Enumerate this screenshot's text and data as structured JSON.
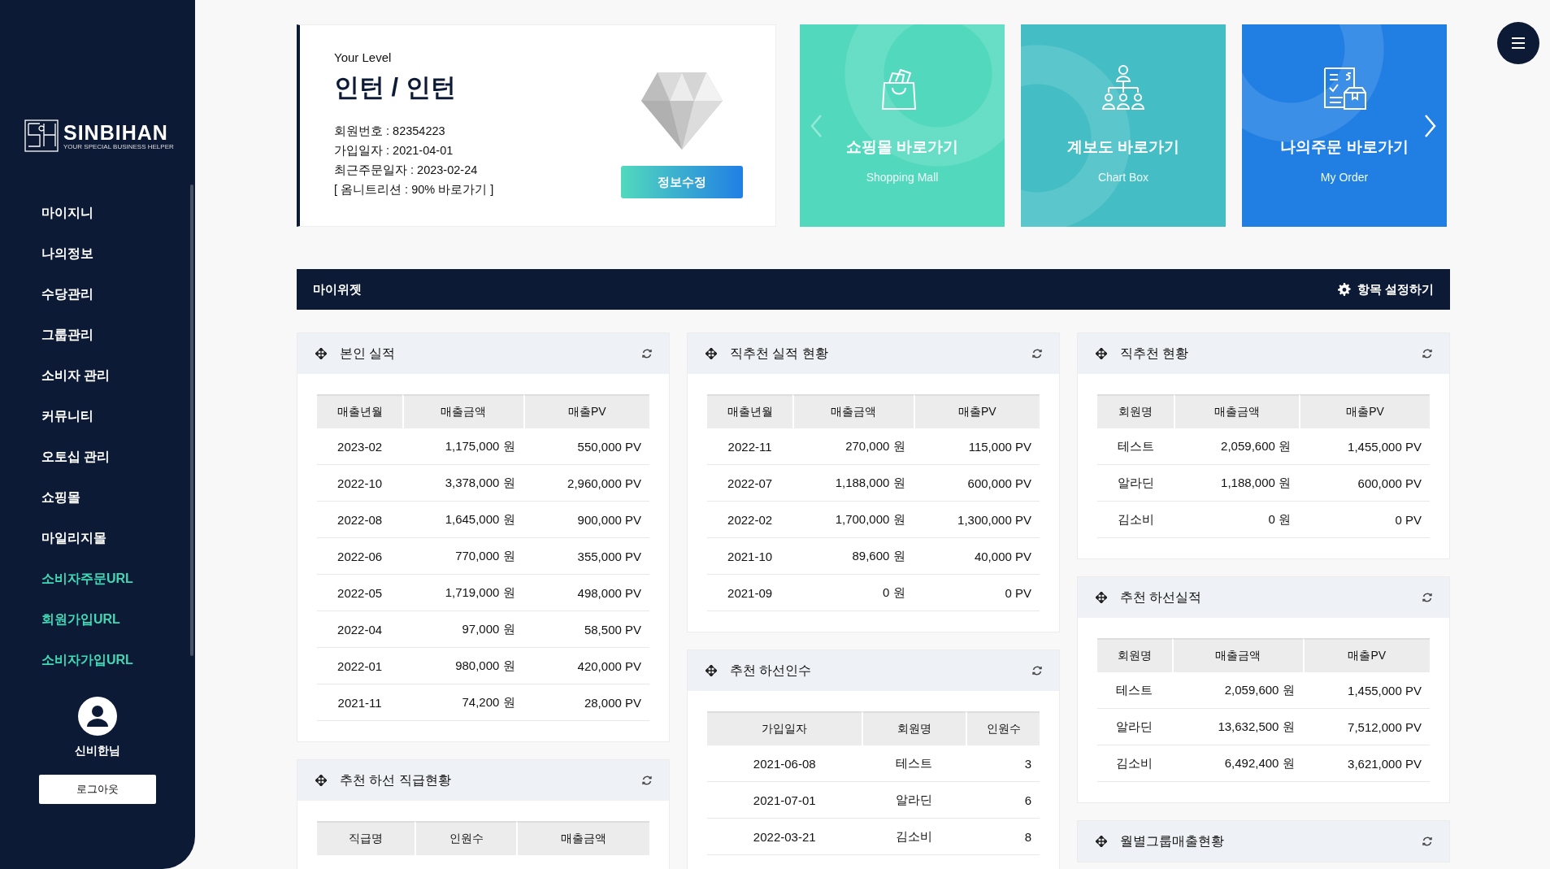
{
  "sidebar": {
    "logo": {
      "name": "SINBIHAN",
      "tagline": "YOUR SPECIAL BUSINESS HELPER"
    },
    "items": [
      {
        "label": "마이지니",
        "kind": "menu"
      },
      {
        "label": "나의정보",
        "kind": "menu"
      },
      {
        "label": "수당관리",
        "kind": "menu"
      },
      {
        "label": "그룹관리",
        "kind": "menu"
      },
      {
        "label": "소비자 관리",
        "kind": "menu"
      },
      {
        "label": "커뮤니티",
        "kind": "menu"
      },
      {
        "label": "오토십 관리",
        "kind": "menu"
      },
      {
        "label": "쇼핑몰",
        "kind": "menu"
      },
      {
        "label": "마일리지몰",
        "kind": "menu"
      },
      {
        "label": "소비자주문URL",
        "kind": "url"
      },
      {
        "label": "회원가입URL",
        "kind": "url"
      },
      {
        "label": "소비자가입URL",
        "kind": "url"
      }
    ],
    "user": {
      "name": "신비한님"
    },
    "logout": "로그아웃"
  },
  "level_card": {
    "caption": "Your Level",
    "title": "인턴 / 인턴",
    "details": [
      "회원번호 : 82354223",
      "가입일자 : 2021-04-01",
      "최근주문일자 : 2023-02-24",
      "[ 옴니트리션 : 90% 바로가기 ]"
    ],
    "button": "정보수정"
  },
  "carousel": {
    "prev": {
      "disabled": true
    },
    "next": {
      "disabled": false
    }
  },
  "shortcuts": [
    {
      "title": "쇼핑몰 바로가기",
      "subtitle": "Shopping Mall",
      "color": "#52d9bd",
      "kind": "shopping"
    },
    {
      "title": "계보도 바로가기",
      "subtitle": "Chart Box",
      "color": "#44bec4",
      "kind": "chart"
    },
    {
      "title": "나의주문 바로가기",
      "subtitle": "My Order",
      "color": "#217fe4",
      "kind": "order"
    }
  ],
  "widget_bar": {
    "title": "마이위젯",
    "action": "항목 설정하기"
  },
  "widget_columns": [
    [
      {
        "title": "본인 실적",
        "columns": [
          {
            "label": "매출년월",
            "kind": "text"
          },
          {
            "label": "매출금액",
            "kind": "number"
          },
          {
            "label": "매출PV",
            "kind": "number"
          }
        ],
        "rows": [
          [
            "2023-02",
            "1,175,000 원",
            "550,000 PV"
          ],
          [
            "2022-10",
            "3,378,000 원",
            "2,960,000 PV"
          ],
          [
            "2022-08",
            "1,645,000 원",
            "900,000 PV"
          ],
          [
            "2022-06",
            "770,000 원",
            "355,000 PV"
          ],
          [
            "2022-05",
            "1,719,000 원",
            "498,000 PV"
          ],
          [
            "2022-04",
            "97,000 원",
            "58,500 PV"
          ],
          [
            "2022-01",
            "980,000 원",
            "420,000 PV"
          ],
          [
            "2021-11",
            "74,200 원",
            "28,000 PV"
          ]
        ]
      },
      {
        "title": "추천 하선 직급현황",
        "columns": [
          {
            "label": "직급명",
            "kind": "text"
          },
          {
            "label": "인원수",
            "kind": "number"
          },
          {
            "label": "매출금액",
            "kind": "number"
          }
        ]
      }
    ],
    [
      {
        "title": "직추천 실적 현황",
        "columns": [
          {
            "label": "매출년월",
            "kind": "text"
          },
          {
            "label": "매출금액",
            "kind": "number"
          },
          {
            "label": "매출PV",
            "kind": "number"
          }
        ],
        "rows": [
          [
            "2022-11",
            "270,000 원",
            "115,000 PV"
          ],
          [
            "2022-07",
            "1,188,000 원",
            "600,000 PV"
          ],
          [
            "2022-02",
            "1,700,000 원",
            "1,300,000 PV"
          ],
          [
            "2021-10",
            "89,600 원",
            "40,000 PV"
          ],
          [
            "2021-09",
            "0 원",
            "0 PV"
          ]
        ]
      },
      {
        "title": "추천 하선인수",
        "columns": [
          {
            "label": "가입일자",
            "kind": "text"
          },
          {
            "label": "회원명",
            "kind": "text"
          },
          {
            "label": "인원수",
            "kind": "number"
          }
        ],
        "rows": [
          [
            "2021-06-08",
            "테스트",
            "3"
          ],
          [
            "2021-07-01",
            "알라딘",
            "6"
          ],
          [
            "2022-03-21",
            "김소비",
            "8"
          ]
        ]
      }
    ],
    [
      {
        "title": "직추천 현황",
        "columns": [
          {
            "label": "회원명",
            "kind": "text"
          },
          {
            "label": "매출금액",
            "kind": "number"
          },
          {
            "label": "매출PV",
            "kind": "number"
          }
        ],
        "rows": [
          [
            "테스트",
            "2,059,600 원",
            "1,455,000 PV"
          ],
          [
            "알라딘",
            "1,188,000 원",
            "600,000 PV"
          ],
          [
            "김소비",
            "0 원",
            "0 PV"
          ]
        ]
      },
      {
        "title": "추천 하선실적",
        "columns": [
          {
            "label": "회원명",
            "kind": "text"
          },
          {
            "label": "매출금액",
            "kind": "number"
          },
          {
            "label": "매출PV",
            "kind": "number"
          }
        ],
        "rows": [
          [
            "테스트",
            "2,059,600 원",
            "1,455,000 PV"
          ],
          [
            "알라딘",
            "13,632,500 원",
            "7,512,000 PV"
          ],
          [
            "김소비",
            "6,492,400 원",
            "3,621,000 PV"
          ]
        ]
      },
      {
        "title": "월별그룹매출현황"
      }
    ]
  ]
}
